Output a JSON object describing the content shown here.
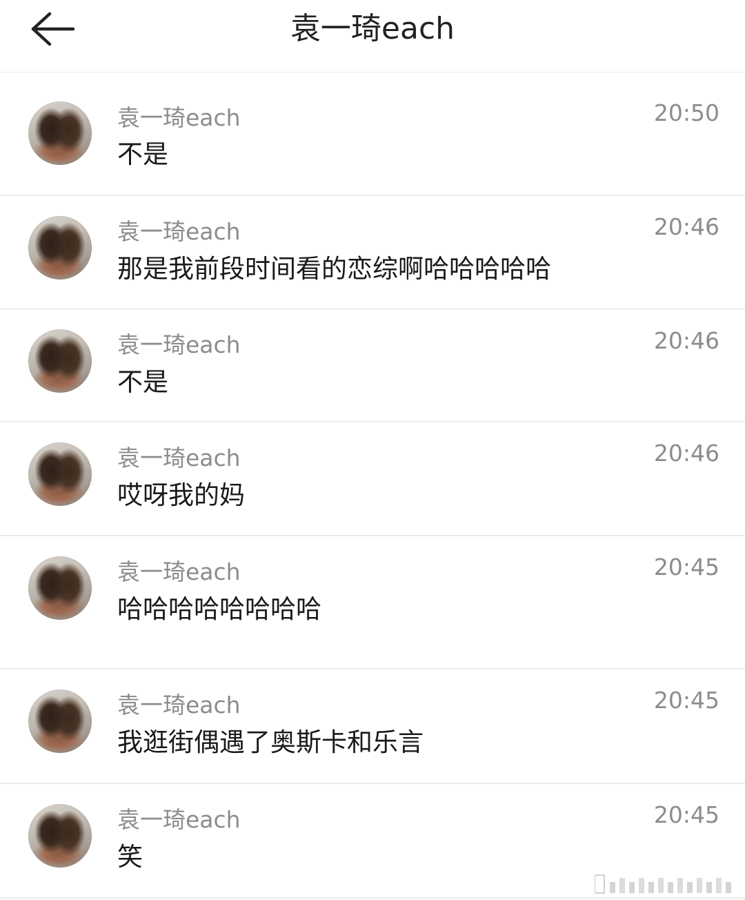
{
  "header": {
    "title": "袁一琦each"
  },
  "messages": [
    {
      "sender": "袁一琦each",
      "text": "不是",
      "time": "20:50"
    },
    {
      "sender": "袁一琦each",
      "text": "那是我前段时间看的恋综啊哈哈哈哈哈",
      "time": "20:46"
    },
    {
      "sender": "袁一琦each",
      "text": "不是",
      "time": "20:46"
    },
    {
      "sender": "袁一琦each",
      "text": "哎呀我的妈",
      "time": "20:46"
    },
    {
      "sender": "袁一琦each",
      "text": "哈哈哈哈哈哈哈哈",
      "time": "20:45"
    },
    {
      "sender": "袁一琦each",
      "text": "我逛街偶遇了奥斯卡和乐言",
      "time": "20:45"
    },
    {
      "sender": "袁一琦each",
      "text": "笑",
      "time": "20:45"
    }
  ],
  "icons": {
    "back": "back-arrow-icon",
    "avatar": "avatar-image"
  }
}
